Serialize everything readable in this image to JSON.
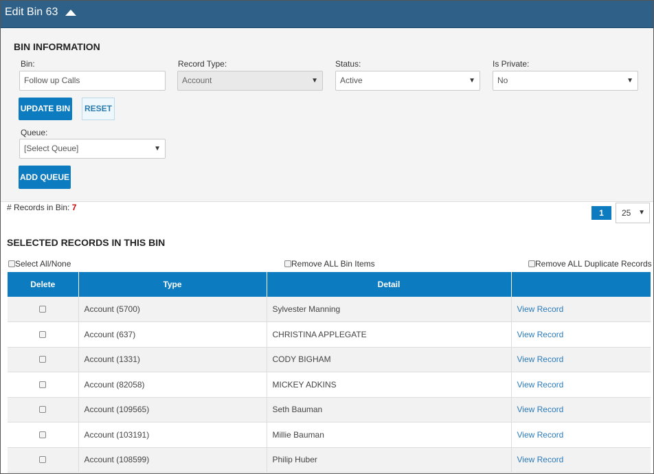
{
  "header": {
    "title": "Edit Bin 63"
  },
  "bin_info": {
    "section_title": "BIN INFORMATION",
    "bin_label": "Bin:",
    "bin_value": "Follow up Calls",
    "record_type_label": "Record Type:",
    "record_type_value": "Account",
    "status_label": "Status:",
    "status_value": "Active",
    "private_label": "Is Private:",
    "private_value": "No",
    "update_label": "UPDATE BIN",
    "reset_label": "RESET",
    "queue_label": "Queue:",
    "queue_value": "[Select Queue]",
    "add_queue_label": "ADD QUEUE"
  },
  "records": {
    "count_label": "# Records in Bin:",
    "count": "7",
    "page": "1",
    "page_size": "25",
    "section_title": "SELECTED RECORDS IN THIS BIN",
    "select_all_label": "Select All/None",
    "remove_all_label": "Remove ALL Bin Items",
    "remove_dupes_label": "Remove ALL Duplicate Records"
  },
  "table": {
    "headers": [
      "Delete",
      "Type",
      "Detail",
      ""
    ],
    "rows": [
      {
        "type": "Account (5700)",
        "detail": "Sylvester Manning",
        "link": "View Record"
      },
      {
        "type": "Account (637)",
        "detail": "CHRISTINA APPLEGATE",
        "link": "View Record"
      },
      {
        "type": "Account (1331)",
        "detail": "CODY BIGHAM",
        "link": "View Record"
      },
      {
        "type": "Account (82058)",
        "detail": "MICKEY ADKINS",
        "link": "View Record"
      },
      {
        "type": "Account (109565)",
        "detail": "Seth Bauman",
        "link": "View Record"
      },
      {
        "type": "Account (103191)",
        "detail": "Millie Bauman",
        "link": "View Record"
      },
      {
        "type": "Account (108599)",
        "detail": "Philip Huber",
        "link": "View Record"
      }
    ]
  },
  "colors": {
    "header_bg": "#2e6088",
    "accent": "#0d7bbf",
    "count_red": "#d10000"
  }
}
